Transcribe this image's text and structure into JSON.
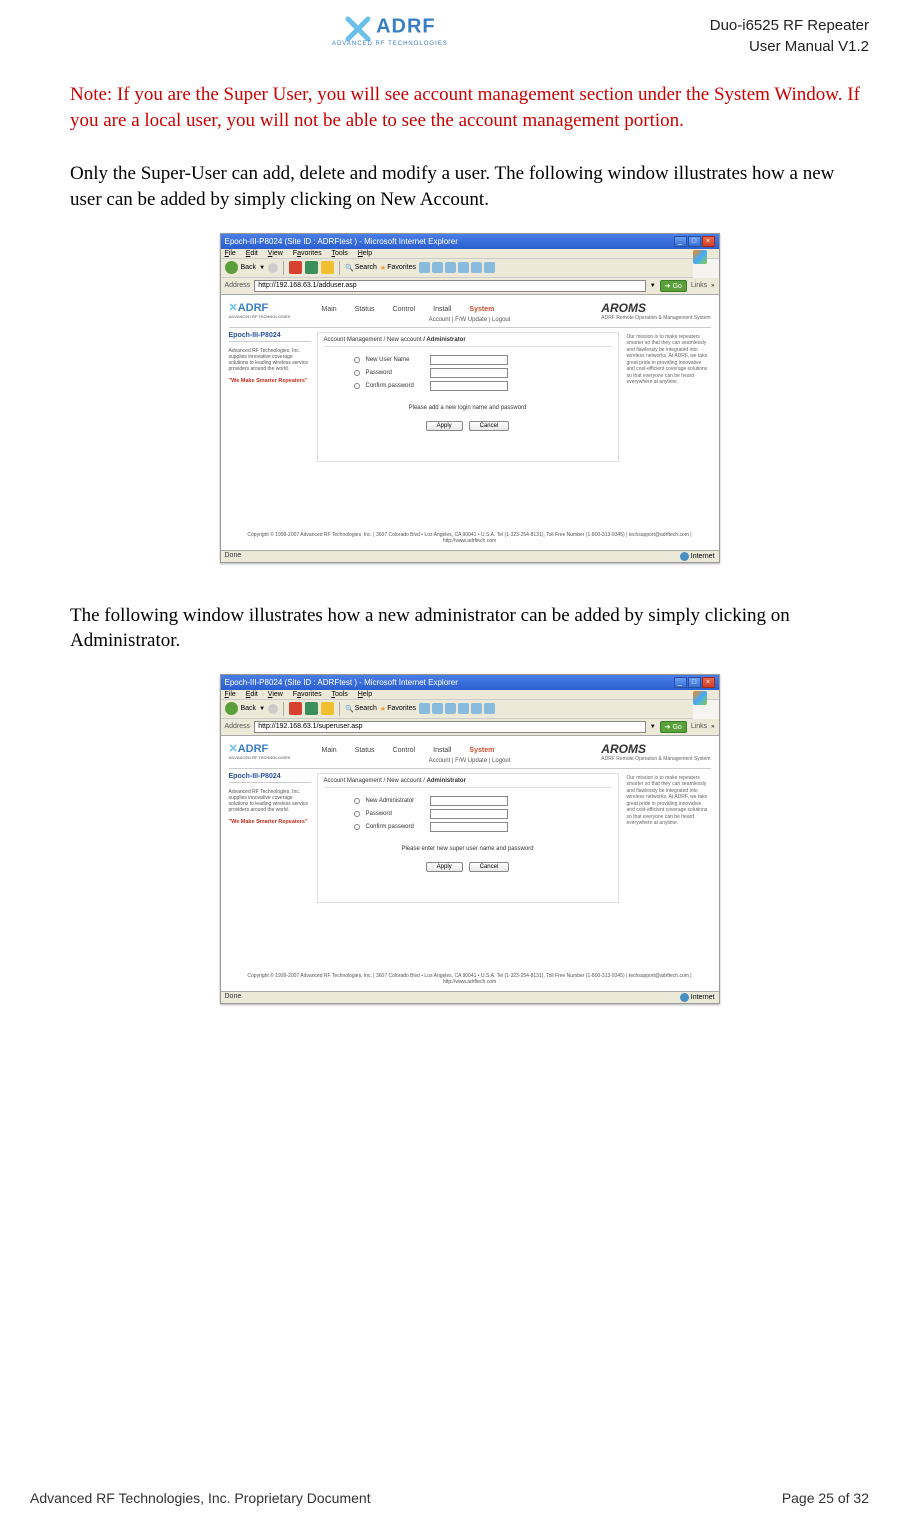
{
  "header": {
    "logo_text": "ADRF",
    "logo_subtitle": "ADVANCED RF TECHNOLOGIES",
    "title_line1": "Duo-i6525 RF Repeater",
    "title_line2": "User Manual V1.2"
  },
  "body": {
    "note": "Note: If you are the Super User, you will see account management section under the System Window.  If you are a local user, you will not be able to see the account management portion.",
    "para1": "Only the Super-User can add, delete and modify a user.  The following window illustrates how a new user can be added by simply clicking on New Account.",
    "para2": "The following window illustrates how a new administrator can be added by simply clicking on Administrator."
  },
  "ie_window": {
    "title": "Epoch-III-P8024 (Site ID : ADRFtest ) - Microsoft Internet Explorer",
    "menu": {
      "file": "File",
      "edit": "Edit",
      "view": "View",
      "favorites": "Favorites",
      "tools": "Tools",
      "help": "Help"
    },
    "toolbar": {
      "back": "Back",
      "search": "Search",
      "favorites": "Favorites"
    },
    "address_label": "Address",
    "url_user": "http://192.168.63.1/adduser.asp",
    "url_admin": "http://192.168.63.1/superuser.asp",
    "go": "Go",
    "links": "Links",
    "tabs": {
      "main": "Main",
      "status": "Status",
      "control": "Control",
      "install": "Install",
      "system": "System"
    },
    "subtabs": "Account    |    F/W Update    |    Logout",
    "aroms": "AROMS",
    "aroms_sub": "ADRF Remote Operation & Management System",
    "sidebar": {
      "title": "Epoch-III-P8024",
      "text": "Advanced RF Technologies, Inc. supplies innovative coverage solutions to leading wireless service providers around the world.",
      "tagline": "\"We Make Smarter Repeaters\""
    },
    "breadcrumb_user": {
      "p1": "Account Management / New account",
      "p2": " / Administrator"
    },
    "breadcrumb_admin": {
      "p1": "Account Management / New account / ",
      "p2": "Administrator"
    },
    "form_user": {
      "f1": "New User Name",
      "f2": "Password",
      "f3": "Confirm password",
      "msg": "Please add a new login name and password"
    },
    "form_admin": {
      "f1": "New Administrator",
      "f2": "Password",
      "f3": "Confirm password",
      "msg": "Please enter new super user name and password"
    },
    "apply": "Apply",
    "cancel": "Cancel",
    "right_panel": "Our mission is to make repeaters smarter so that they can seamlessly and flawlessly be integrated into wireless networks.\n\nAt ADRF, we take great pride in providing innovative and cost-efficient coverage solutions so that everyone can be heard everywhere at anytime.",
    "copyright": "Copyright © 1999-2007 Advanced RF Technologies, Inc. | 3607 Colorado Blvd • Los Angeles, CA 90041 • U.S.A.\nTel (1-323-254-8131), Toll Free Number (1-800-313-9345) | techsupport@adrftech.com | http://www.adrftech.com",
    "status_done": "Done",
    "status_net": "Internet"
  },
  "footer": {
    "left": "Advanced RF Technologies, Inc. Proprietary Document",
    "right": "Page 25 of 32"
  }
}
